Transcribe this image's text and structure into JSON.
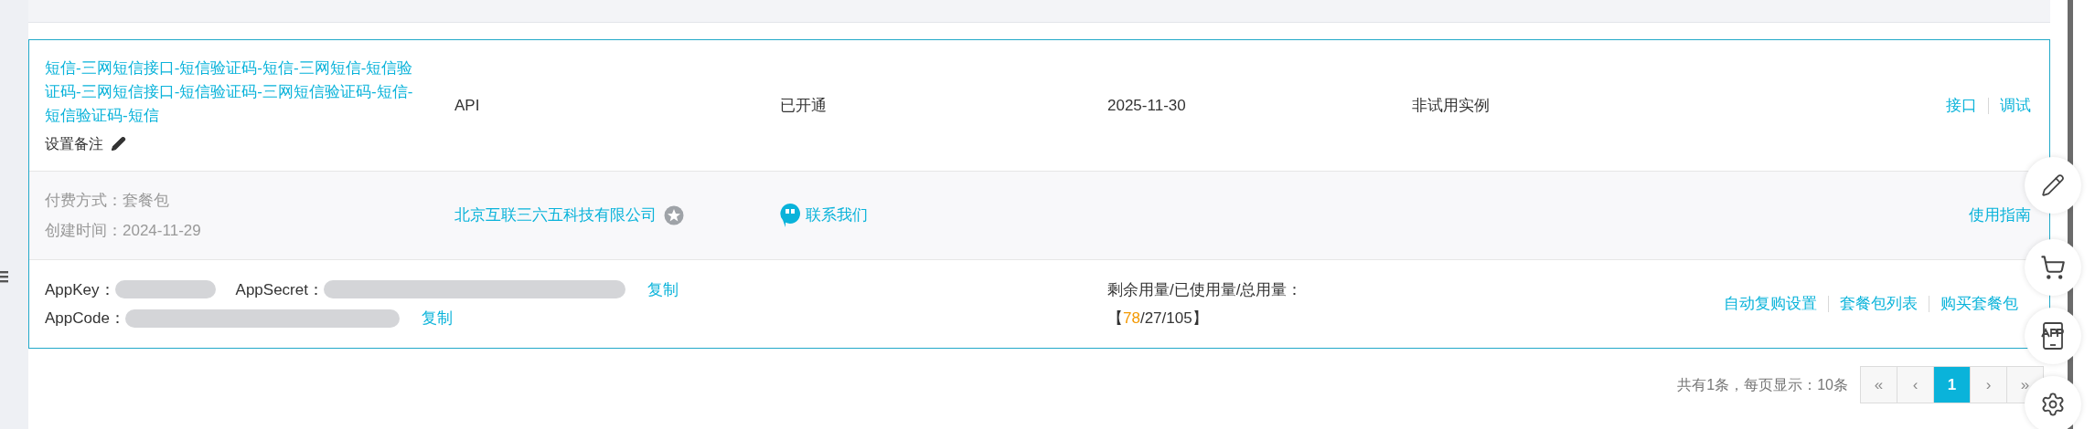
{
  "table": {
    "rows": [
      {
        "product": "短信-三网短信接口-短信验证码-短信-三网短信-短信验证码-三网短信接口-短信验证码-三网短信验证码-短信-短信验证码-短信",
        "note_label": "设置备注",
        "type": "API",
        "status": "已开通",
        "expiry": "2025-11-30",
        "trial": "非试用实例",
        "actions": [
          "接口",
          "调试"
        ],
        "payment": {
          "label": "付费方式：",
          "value": "套餐包"
        },
        "created": {
          "label": "创建时间：",
          "value": "2024-11-29"
        },
        "vendor": "北京互联三六五科技有限公司",
        "contact": "联系我们",
        "guide": "使用指南",
        "credential_lines": [
          {
            "fields": [
              "AppKey：",
              "AppSecret："
            ],
            "copy": "复制"
          },
          {
            "fields": [
              "AppCode："
            ],
            "copy": "复制"
          }
        ],
        "usage_label": "剩余用量/已使用量/总用量：",
        "usage_parts": [
          {
            "text": "【",
            "kind": "plain"
          },
          {
            "text": "78",
            "kind": "highlight"
          },
          {
            "text": "/27/105】",
            "kind": "plain"
          }
        ],
        "package_actions": [
          "自动复购设置",
          "套餐包列表",
          "购买套餐包"
        ]
      }
    ]
  },
  "pagination": {
    "summary": "共有1条，每页显示：10条",
    "pages": [
      {
        "label": "«",
        "selected": false,
        "disabled": true
      },
      {
        "label": "‹",
        "selected": false,
        "disabled": true
      },
      {
        "label": "1",
        "selected": true,
        "disabled": false
      },
      {
        "label": "›",
        "selected": false,
        "disabled": true
      },
      {
        "label": "»",
        "selected": false,
        "disabled": true
      }
    ]
  }
}
